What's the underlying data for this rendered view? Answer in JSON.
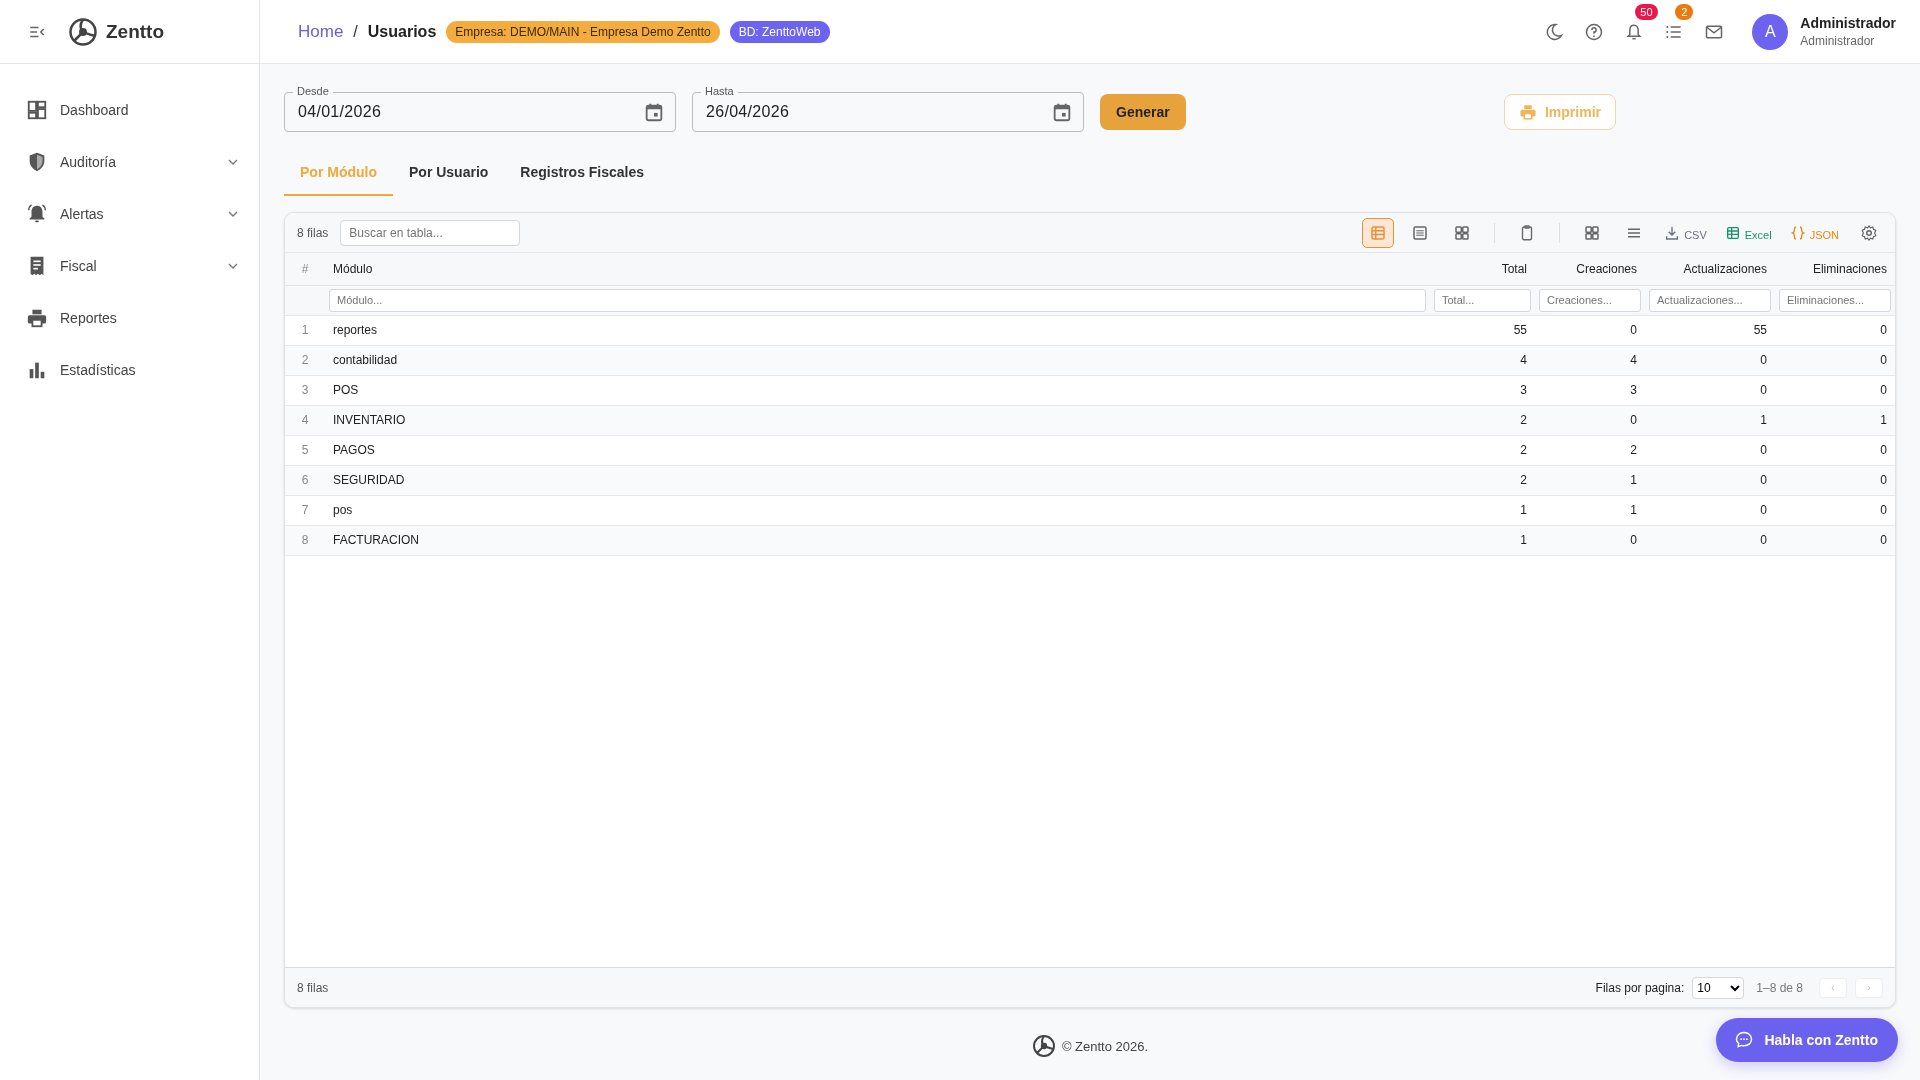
{
  "sidebar": {
    "logo": "Zentto",
    "items": [
      {
        "label": "Dashboard",
        "expandable": false
      },
      {
        "label": "Auditoría",
        "expandable": true
      },
      {
        "label": "Alertas",
        "expandable": true
      },
      {
        "label": "Fiscal",
        "expandable": true
      },
      {
        "label": "Reportes",
        "expandable": false
      },
      {
        "label": "Estadísticas",
        "expandable": false
      }
    ]
  },
  "topbar": {
    "breadcrumb_separator": "/",
    "breadcrumb": [
      {
        "label": "Home",
        "link": true
      },
      {
        "label": "Usuarios",
        "link": false
      }
    ],
    "chips": [
      {
        "label": "Empresa: DEMO/MAIN - Empresa Demo Zentto",
        "color": "#f5ac3f"
      },
      {
        "label": "BD: ZenttoWeb",
        "color": "#6c63f0"
      }
    ],
    "actions": [
      {
        "kind": "theme"
      },
      {
        "kind": "help"
      },
      {
        "kind": "notifications",
        "badge": "50",
        "color": "#e8194a"
      },
      {
        "kind": "tasks",
        "badge": "2",
        "color": "#ea7a0c"
      },
      {
        "kind": "mail"
      }
    ],
    "user": {
      "initial": "A",
      "name": "Administrador",
      "role": "Administrador"
    }
  },
  "filters": [
    {
      "label": "Desde",
      "value": "04/01/2026"
    },
    {
      "label": "Hasta",
      "value": "26/04/2026"
    }
  ],
  "generate_button": "Generar",
  "print_button": "Imprimir",
  "tabs": [
    {
      "label": "Por Módulo",
      "selected": true
    },
    {
      "label": "Por Usuario",
      "selected": false
    },
    {
      "label": "Registros Fiscales",
      "selected": false
    }
  ],
  "table": {
    "row_count": "8 filas",
    "search_placeholder": "Buscar en tabla...",
    "view_modes": [
      {
        "kind": "table",
        "selected": true
      },
      {
        "kind": "list",
        "selected": false
      },
      {
        "kind": "grid",
        "selected": false
      }
    ],
    "tools": [
      {
        "kind": "copy"
      },
      {
        "kind": "columns"
      },
      {
        "kind": "density"
      }
    ],
    "exports": [
      {
        "kind": "csv",
        "label": "CSV",
        "color": "#6b7280"
      },
      {
        "kind": "excel",
        "label": "Excel",
        "color": "#16956b"
      },
      {
        "kind": "json",
        "label": "JSON",
        "color": "#e58a12"
      }
    ],
    "columns": [
      {
        "label": "#"
      },
      {
        "label": "Módulo",
        "placeholder": "Módulo..."
      },
      {
        "label": "Total",
        "placeholder": "Total..."
      },
      {
        "label": "Creaciones",
        "placeholder": "Creaciones..."
      },
      {
        "label": "Actualizaciones",
        "placeholder": "Actualizaciones..."
      },
      {
        "label": "Eliminaciones",
        "placeholder": "Eliminaciones..."
      }
    ],
    "rows": [
      [
        "1",
        "reportes",
        "55",
        "0",
        "55",
        "0"
      ],
      [
        "2",
        "contabilidad",
        "4",
        "4",
        "0",
        "0"
      ],
      [
        "3",
        "POS",
        "3",
        "3",
        "0",
        "0"
      ],
      [
        "4",
        "INVENTARIO",
        "2",
        "0",
        "1",
        "1"
      ],
      [
        "5",
        "PAGOS",
        "2",
        "2",
        "0",
        "0"
      ],
      [
        "6",
        "SEGURIDAD",
        "2",
        "1",
        "0",
        "0"
      ],
      [
        "7",
        "pos",
        "1",
        "1",
        "0",
        "0"
      ],
      [
        "8",
        "FACTURACION",
        "1",
        "0",
        "0",
        "0"
      ]
    ],
    "footer": {
      "row_count": "8 filas",
      "rows_per_page_label": "Filas por pagina:",
      "rows_per_page": "10",
      "range": "1–8 de 8",
      "prev": "‹",
      "next": "›",
      "prev_disabled": true,
      "next_disabled": true
    }
  },
  "page_footer": "© Zentto 2026.",
  "chat_button": "Habla con Zentto"
}
